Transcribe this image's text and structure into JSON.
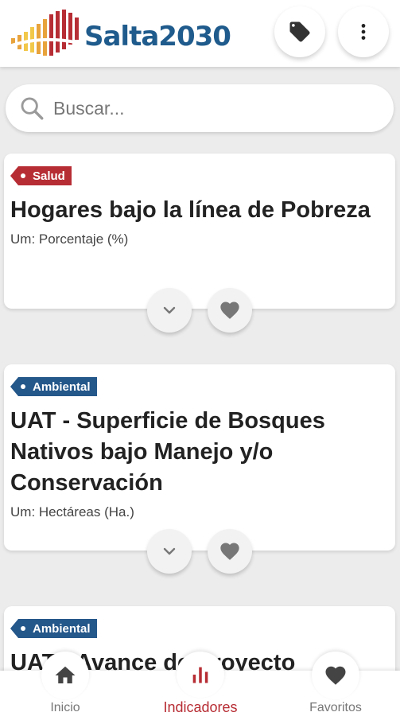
{
  "header": {
    "logo_text": "Salta2030",
    "logo_colors": [
      "#b72d34",
      "#e8a33c",
      "#f2c84b"
    ],
    "tag_icon": "tag-icon",
    "more_icon": "more-vertical-icon"
  },
  "search": {
    "placeholder": "Buscar...",
    "icon": "search-icon"
  },
  "cards": [
    {
      "category": "Salud",
      "category_color": "#b72d34",
      "title": "Hogares bajo la línea de Pobreza",
      "unit": "Um: Porcentaje (%)"
    },
    {
      "category": "Ambiental",
      "category_color": "#24578a",
      "title": "UAT - Superficie de Bosques Nativos bajo Manejo y/o Conservación",
      "unit": "Um: Hectáreas (Ha.)"
    },
    {
      "category": "Ambiental",
      "category_color": "#24578a",
      "title": "UAT - Avance de Proyecto",
      "unit": ""
    }
  ],
  "bottom_nav": {
    "items": [
      {
        "label": "Inicio",
        "icon": "home-icon"
      },
      {
        "label": "Indicadores",
        "icon": "bar-chart-icon"
      },
      {
        "label": "Favoritos",
        "icon": "heart-icon"
      }
    ],
    "active_color": "#b72d34"
  }
}
